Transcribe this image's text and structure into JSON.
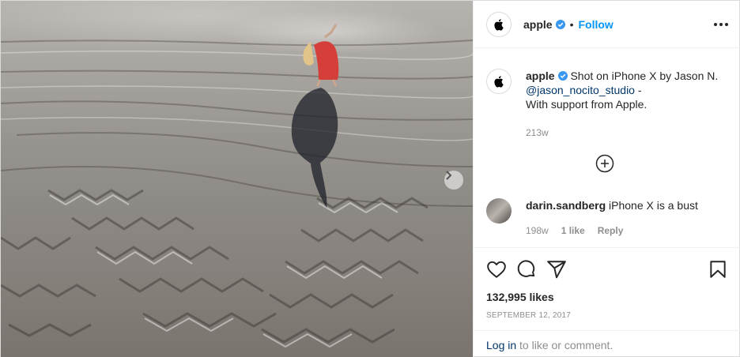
{
  "post": {
    "username": "apple",
    "follow_label": "Follow",
    "separator": "•",
    "caption": "Shot on iPhone X by Jason N.",
    "mention": "@jason_nocito_studio",
    "caption_suffix": " -",
    "caption_line2": "With support from Apple.",
    "caption_time": "213w"
  },
  "comment": {
    "username": "darin.sandberg",
    "text": "iPhone X is a bust",
    "time": "198w",
    "likes": "1 like",
    "reply_label": "Reply"
  },
  "stats": {
    "likes": "132,995 likes",
    "date": "SEPTEMBER 12, 2017"
  },
  "login": {
    "link_label": "Log in",
    "rest": " to like or comment."
  },
  "icons": {
    "verified": "verified-badge-icon",
    "more": "more-options-icon",
    "load_more": "add-circle-icon",
    "like": "heart-icon",
    "comment": "comment-bubble-icon",
    "share": "paper-plane-icon",
    "save": "bookmark-icon",
    "next": "chevron-right-icon",
    "avatar_logo": "apple-logo-icon"
  },
  "colors": {
    "follow": "#0095f6",
    "link": "#00376b",
    "muted": "#8e8e8e",
    "verified": "#3897f0"
  }
}
